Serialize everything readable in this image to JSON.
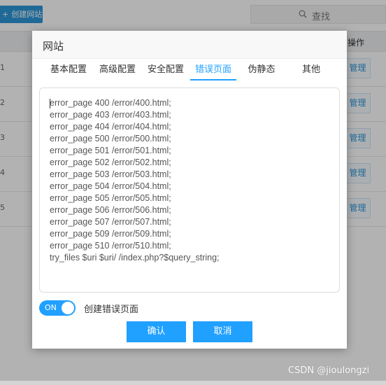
{
  "background": {
    "create_button": "创建网站",
    "search_placeholder": "查找",
    "table_header": {
      "operation": "操作"
    },
    "rows": [
      {
        "num": "1",
        "action": "管理"
      },
      {
        "num": "2",
        "action": "管理"
      },
      {
        "num": "3",
        "action": "管理"
      },
      {
        "num": "4",
        "action": "管理"
      },
      {
        "num": "5",
        "action": "管理"
      }
    ]
  },
  "modal": {
    "title": "网站",
    "tabs": [
      "基本配置",
      "高级配置",
      "安全配置",
      "错误页面",
      "伪静态",
      "其他"
    ],
    "active_tab": "错误页面",
    "config_lines": [
      "error_page 400 /error/400.html;",
      "error_page 403 /error/403.html;",
      "error_page 404 /error/404.html;",
      "error_page 500 /error/500.html;",
      "error_page 501 /error/501.html;",
      "error_page 502 /error/502.html;",
      "error_page 503 /error/503.html;",
      "error_page 504 /error/504.html;",
      "error_page 505 /error/505.html;",
      "error_page 506 /error/506.html;",
      "error_page 507 /error/507.html;",
      "error_page 509 /error/509.html;",
      "error_page 510 /error/510.html;",
      "try_files $uri $uri/ /index.php?$query_string;"
    ],
    "toggle": {
      "state_text": "ON",
      "label": "创建错误页面",
      "on": true
    },
    "buttons": {
      "confirm": "确认",
      "cancel": "取消"
    }
  },
  "watermark": "CSDN @jioulongzi",
  "colors": {
    "accent": "#20a0ff",
    "button_blue": "#2d97d8",
    "overlay": "rgba(0,0,0,0.3)"
  }
}
